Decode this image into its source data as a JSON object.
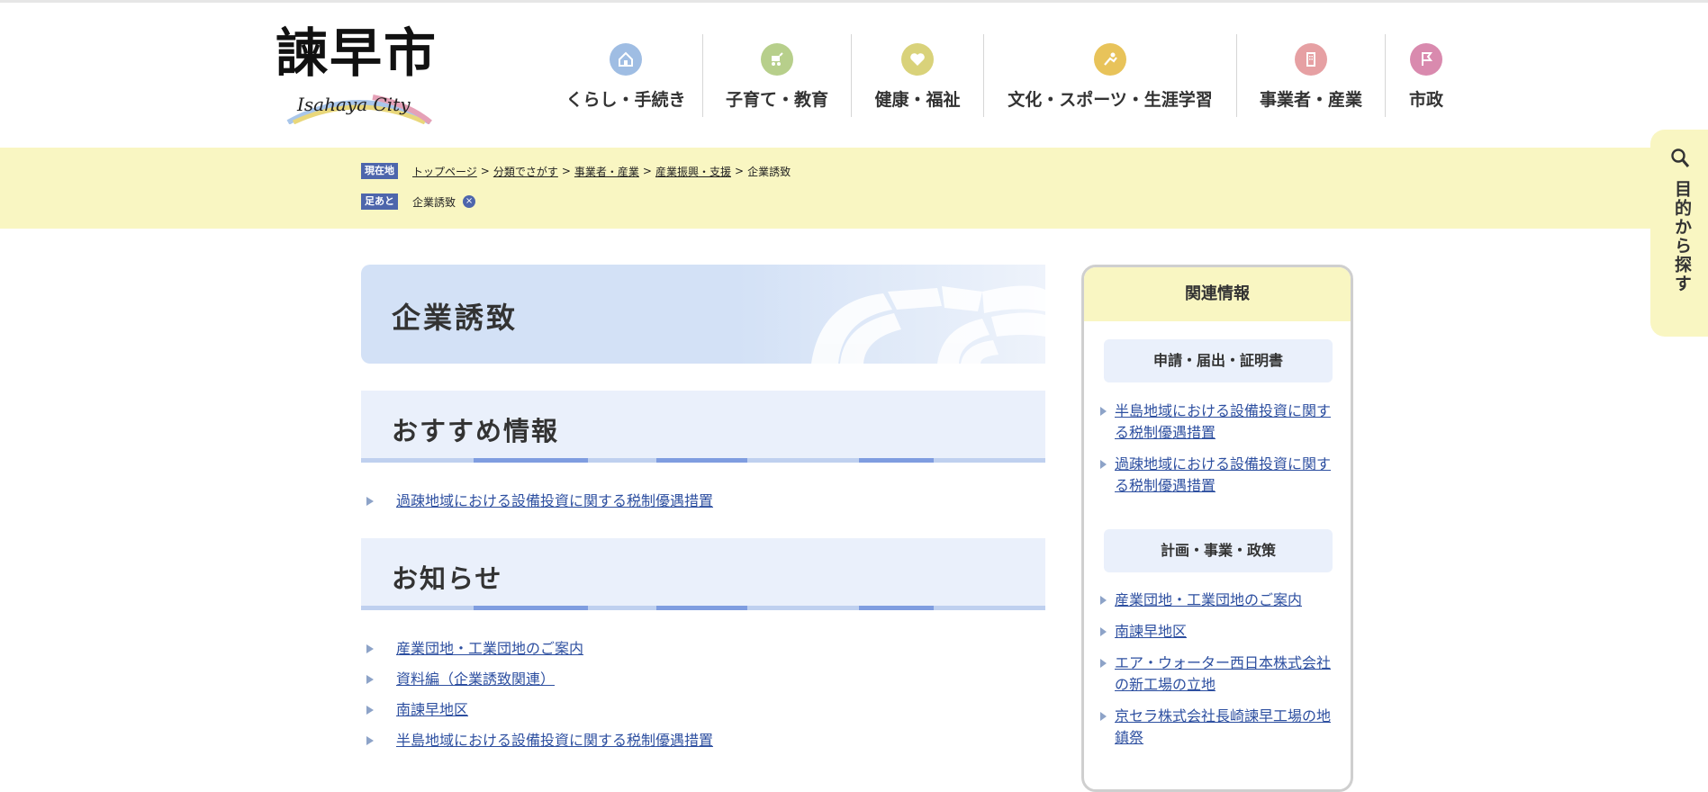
{
  "header": {
    "logo_text": "諫早市",
    "logo_sub": "Isahaya City",
    "nav": [
      {
        "label": "くらし・手続き",
        "icon": "house-icon",
        "color": "#9fbde3"
      },
      {
        "label": "子育て・教育",
        "icon": "stroller-icon",
        "color": "#b7cf8b"
      },
      {
        "label": "健康・福祉",
        "icon": "heart-icon",
        "color": "#d9d27a"
      },
      {
        "label": "文化・スポーツ・生涯学習",
        "icon": "sports-icon",
        "color": "#e8c35a"
      },
      {
        "label": "事業者・産業",
        "icon": "building-icon",
        "color": "#e6a0a3"
      },
      {
        "label": "市政",
        "icon": "flag-icon",
        "color": "#d98aae"
      }
    ]
  },
  "breadcrumb": {
    "tag": "現在地",
    "items": [
      "トップページ",
      "分類でさがす",
      "事業者・産業",
      "産業振興・支援"
    ],
    "current": "企業誘致"
  },
  "footprint": {
    "tag": "足あと",
    "item": "企業誘致"
  },
  "side_tab": {
    "label": "目的から探す"
  },
  "main": {
    "title": "企業誘致",
    "sections": [
      {
        "title": "おすすめ情報",
        "links": [
          "過疎地域における設備投資に関する税制優遇措置"
        ]
      },
      {
        "title": "お知らせ",
        "links": [
          "産業団地・工業団地のご案内",
          "資料編（企業誘致関連）",
          "南諫早地区",
          "半島地域における設備投資に関する税制優遇措置"
        ]
      }
    ]
  },
  "related": {
    "title": "関連情報",
    "categories": [
      {
        "name": "申請・届出・証明書",
        "links": [
          "半島地域における設備投資に関する税制優遇措置",
          "過疎地域における設備投資に関する税制優遇措置"
        ]
      },
      {
        "name": "計画・事業・政策",
        "links": [
          "産業団地・工業団地のご案内",
          "南諫早地区",
          "エア・ウォーター西日本株式会社の新工場の立地",
          "京セラ株式会社長崎諫早工場の地鎮祭"
        ]
      }
    ]
  },
  "colors": {
    "accent": "#4e66ac",
    "band": "#f9f6c2",
    "link": "#2d4fa0"
  }
}
